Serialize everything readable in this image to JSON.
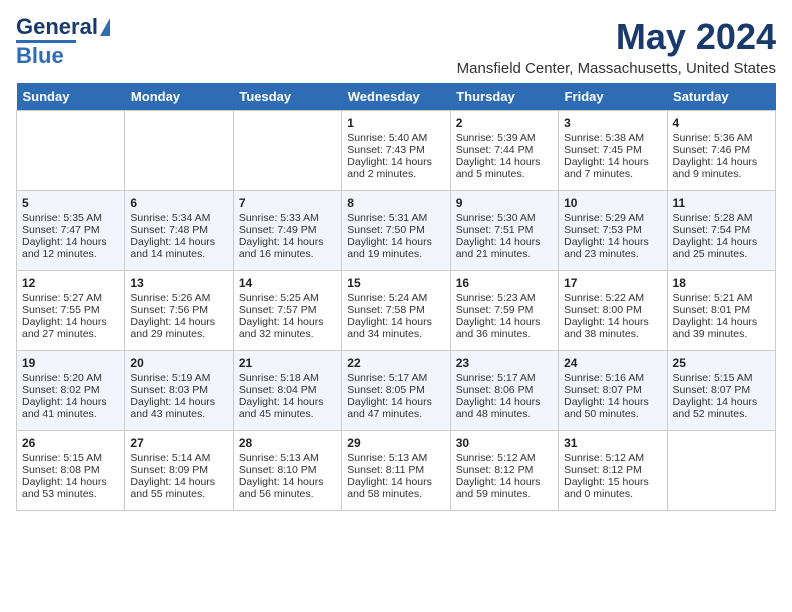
{
  "header": {
    "logo_general": "General",
    "logo_blue": "Blue",
    "month_year": "May 2024",
    "location": "Mansfield Center, Massachusetts, United States"
  },
  "weekdays": [
    "Sunday",
    "Monday",
    "Tuesday",
    "Wednesday",
    "Thursday",
    "Friday",
    "Saturday"
  ],
  "weeks": [
    [
      {
        "day": "",
        "sunrise": "",
        "sunset": "",
        "daylight": ""
      },
      {
        "day": "",
        "sunrise": "",
        "sunset": "",
        "daylight": ""
      },
      {
        "day": "",
        "sunrise": "",
        "sunset": "",
        "daylight": ""
      },
      {
        "day": "1",
        "sunrise": "Sunrise: 5:40 AM",
        "sunset": "Sunset: 7:43 PM",
        "daylight": "Daylight: 14 hours and 2 minutes."
      },
      {
        "day": "2",
        "sunrise": "Sunrise: 5:39 AM",
        "sunset": "Sunset: 7:44 PM",
        "daylight": "Daylight: 14 hours and 5 minutes."
      },
      {
        "day": "3",
        "sunrise": "Sunrise: 5:38 AM",
        "sunset": "Sunset: 7:45 PM",
        "daylight": "Daylight: 14 hours and 7 minutes."
      },
      {
        "day": "4",
        "sunrise": "Sunrise: 5:36 AM",
        "sunset": "Sunset: 7:46 PM",
        "daylight": "Daylight: 14 hours and 9 minutes."
      }
    ],
    [
      {
        "day": "5",
        "sunrise": "Sunrise: 5:35 AM",
        "sunset": "Sunset: 7:47 PM",
        "daylight": "Daylight: 14 hours and 12 minutes."
      },
      {
        "day": "6",
        "sunrise": "Sunrise: 5:34 AM",
        "sunset": "Sunset: 7:48 PM",
        "daylight": "Daylight: 14 hours and 14 minutes."
      },
      {
        "day": "7",
        "sunrise": "Sunrise: 5:33 AM",
        "sunset": "Sunset: 7:49 PM",
        "daylight": "Daylight: 14 hours and 16 minutes."
      },
      {
        "day": "8",
        "sunrise": "Sunrise: 5:31 AM",
        "sunset": "Sunset: 7:50 PM",
        "daylight": "Daylight: 14 hours and 19 minutes."
      },
      {
        "day": "9",
        "sunrise": "Sunrise: 5:30 AM",
        "sunset": "Sunset: 7:51 PM",
        "daylight": "Daylight: 14 hours and 21 minutes."
      },
      {
        "day": "10",
        "sunrise": "Sunrise: 5:29 AM",
        "sunset": "Sunset: 7:53 PM",
        "daylight": "Daylight: 14 hours and 23 minutes."
      },
      {
        "day": "11",
        "sunrise": "Sunrise: 5:28 AM",
        "sunset": "Sunset: 7:54 PM",
        "daylight": "Daylight: 14 hours and 25 minutes."
      }
    ],
    [
      {
        "day": "12",
        "sunrise": "Sunrise: 5:27 AM",
        "sunset": "Sunset: 7:55 PM",
        "daylight": "Daylight: 14 hours and 27 minutes."
      },
      {
        "day": "13",
        "sunrise": "Sunrise: 5:26 AM",
        "sunset": "Sunset: 7:56 PM",
        "daylight": "Daylight: 14 hours and 29 minutes."
      },
      {
        "day": "14",
        "sunrise": "Sunrise: 5:25 AM",
        "sunset": "Sunset: 7:57 PM",
        "daylight": "Daylight: 14 hours and 32 minutes."
      },
      {
        "day": "15",
        "sunrise": "Sunrise: 5:24 AM",
        "sunset": "Sunset: 7:58 PM",
        "daylight": "Daylight: 14 hours and 34 minutes."
      },
      {
        "day": "16",
        "sunrise": "Sunrise: 5:23 AM",
        "sunset": "Sunset: 7:59 PM",
        "daylight": "Daylight: 14 hours and 36 minutes."
      },
      {
        "day": "17",
        "sunrise": "Sunrise: 5:22 AM",
        "sunset": "Sunset: 8:00 PM",
        "daylight": "Daylight: 14 hours and 38 minutes."
      },
      {
        "day": "18",
        "sunrise": "Sunrise: 5:21 AM",
        "sunset": "Sunset: 8:01 PM",
        "daylight": "Daylight: 14 hours and 39 minutes."
      }
    ],
    [
      {
        "day": "19",
        "sunrise": "Sunrise: 5:20 AM",
        "sunset": "Sunset: 8:02 PM",
        "daylight": "Daylight: 14 hours and 41 minutes."
      },
      {
        "day": "20",
        "sunrise": "Sunrise: 5:19 AM",
        "sunset": "Sunset: 8:03 PM",
        "daylight": "Daylight: 14 hours and 43 minutes."
      },
      {
        "day": "21",
        "sunrise": "Sunrise: 5:18 AM",
        "sunset": "Sunset: 8:04 PM",
        "daylight": "Daylight: 14 hours and 45 minutes."
      },
      {
        "day": "22",
        "sunrise": "Sunrise: 5:17 AM",
        "sunset": "Sunset: 8:05 PM",
        "daylight": "Daylight: 14 hours and 47 minutes."
      },
      {
        "day": "23",
        "sunrise": "Sunrise: 5:17 AM",
        "sunset": "Sunset: 8:06 PM",
        "daylight": "Daylight: 14 hours and 48 minutes."
      },
      {
        "day": "24",
        "sunrise": "Sunrise: 5:16 AM",
        "sunset": "Sunset: 8:07 PM",
        "daylight": "Daylight: 14 hours and 50 minutes."
      },
      {
        "day": "25",
        "sunrise": "Sunrise: 5:15 AM",
        "sunset": "Sunset: 8:07 PM",
        "daylight": "Daylight: 14 hours and 52 minutes."
      }
    ],
    [
      {
        "day": "26",
        "sunrise": "Sunrise: 5:15 AM",
        "sunset": "Sunset: 8:08 PM",
        "daylight": "Daylight: 14 hours and 53 minutes."
      },
      {
        "day": "27",
        "sunrise": "Sunrise: 5:14 AM",
        "sunset": "Sunset: 8:09 PM",
        "daylight": "Daylight: 14 hours and 55 minutes."
      },
      {
        "day": "28",
        "sunrise": "Sunrise: 5:13 AM",
        "sunset": "Sunset: 8:10 PM",
        "daylight": "Daylight: 14 hours and 56 minutes."
      },
      {
        "day": "29",
        "sunrise": "Sunrise: 5:13 AM",
        "sunset": "Sunset: 8:11 PM",
        "daylight": "Daylight: 14 hours and 58 minutes."
      },
      {
        "day": "30",
        "sunrise": "Sunrise: 5:12 AM",
        "sunset": "Sunset: 8:12 PM",
        "daylight": "Daylight: 14 hours and 59 minutes."
      },
      {
        "day": "31",
        "sunrise": "Sunrise: 5:12 AM",
        "sunset": "Sunset: 8:12 PM",
        "daylight": "Daylight: 15 hours and 0 minutes."
      },
      {
        "day": "",
        "sunrise": "",
        "sunset": "",
        "daylight": ""
      }
    ]
  ]
}
